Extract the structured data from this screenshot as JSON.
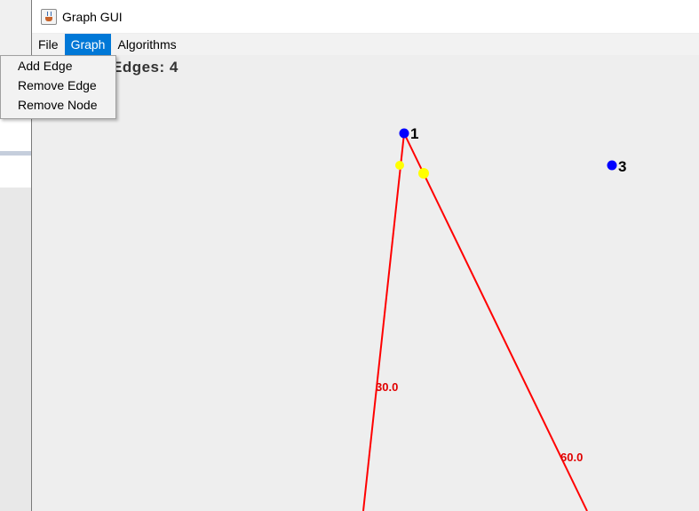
{
  "window": {
    "title": "Graph GUI"
  },
  "menubar": {
    "items": [
      {
        "label": "File"
      },
      {
        "label": "Graph"
      },
      {
        "label": "Algorithms"
      }
    ]
  },
  "graph_menu": {
    "items": [
      {
        "label": "Add Edge"
      },
      {
        "label": "Remove Edge"
      },
      {
        "label": "Remove Node"
      }
    ]
  },
  "canvas": {
    "edges_text": "Edges: 4",
    "nodes": [
      {
        "label": "1"
      },
      {
        "label": "3"
      }
    ],
    "edge_weights": [
      "30.0",
      "60.0"
    ]
  },
  "colors": {
    "node": "#0000ff",
    "edge": "#ff0000",
    "arrow_marker": "#ffff00",
    "menu_highlight": "#0078d7"
  }
}
